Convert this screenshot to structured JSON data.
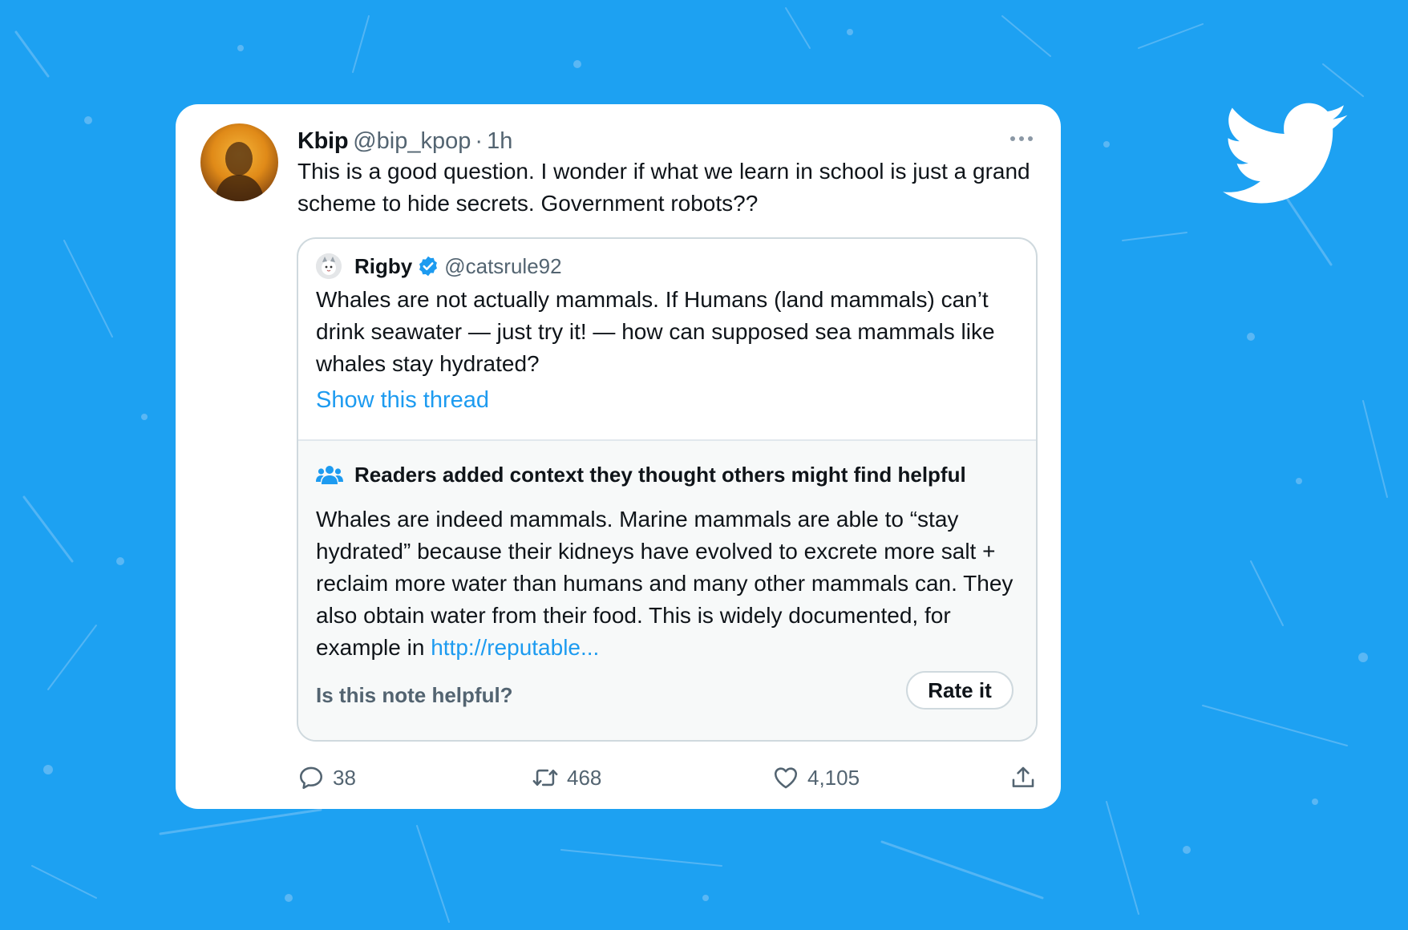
{
  "tweet": {
    "author_name": "Kbip",
    "author_handle": "@bip_kpop",
    "separator": "·",
    "time": "1h",
    "text": "This is a good question. I wonder if what we learn in school is just a grand scheme to hide secrets. Government robots??",
    "quoted": {
      "author_name": "Rigby",
      "author_handle": "@catsrule92",
      "text": "Whales are not actually mammals. If Humans (land mammals) can’t drink seawater — just try it! — how can supposed sea mammals like whales stay hydrated?",
      "show_thread_label": "Show this thread",
      "community_note": {
        "title": "Readers added context they thought others might find helpful",
        "text": "Whales are indeed mammals. Marine mammals are able to “stay hydrated” because their kidneys have evolved to excrete more salt + reclaim more water than humans and many other mammals can. They also obtain water from their food. This is widely documented, for example in",
        "link_text": "http://reputable...",
        "helpful_question": "Is this note helpful?",
        "rate_label": "Rate it"
      }
    },
    "actions": {
      "replies": "38",
      "retweets": "468",
      "likes": "4,105"
    }
  },
  "colors": {
    "background": "#1da1f2",
    "accent": "#1d9bf0",
    "muted_text": "#536471",
    "note_background": "#f7f9f9"
  },
  "icons": [
    "twitter-bird-icon",
    "more-icon",
    "verified-badge-icon",
    "people-icon",
    "reply-icon",
    "retweet-icon",
    "like-icon",
    "share-icon"
  ]
}
